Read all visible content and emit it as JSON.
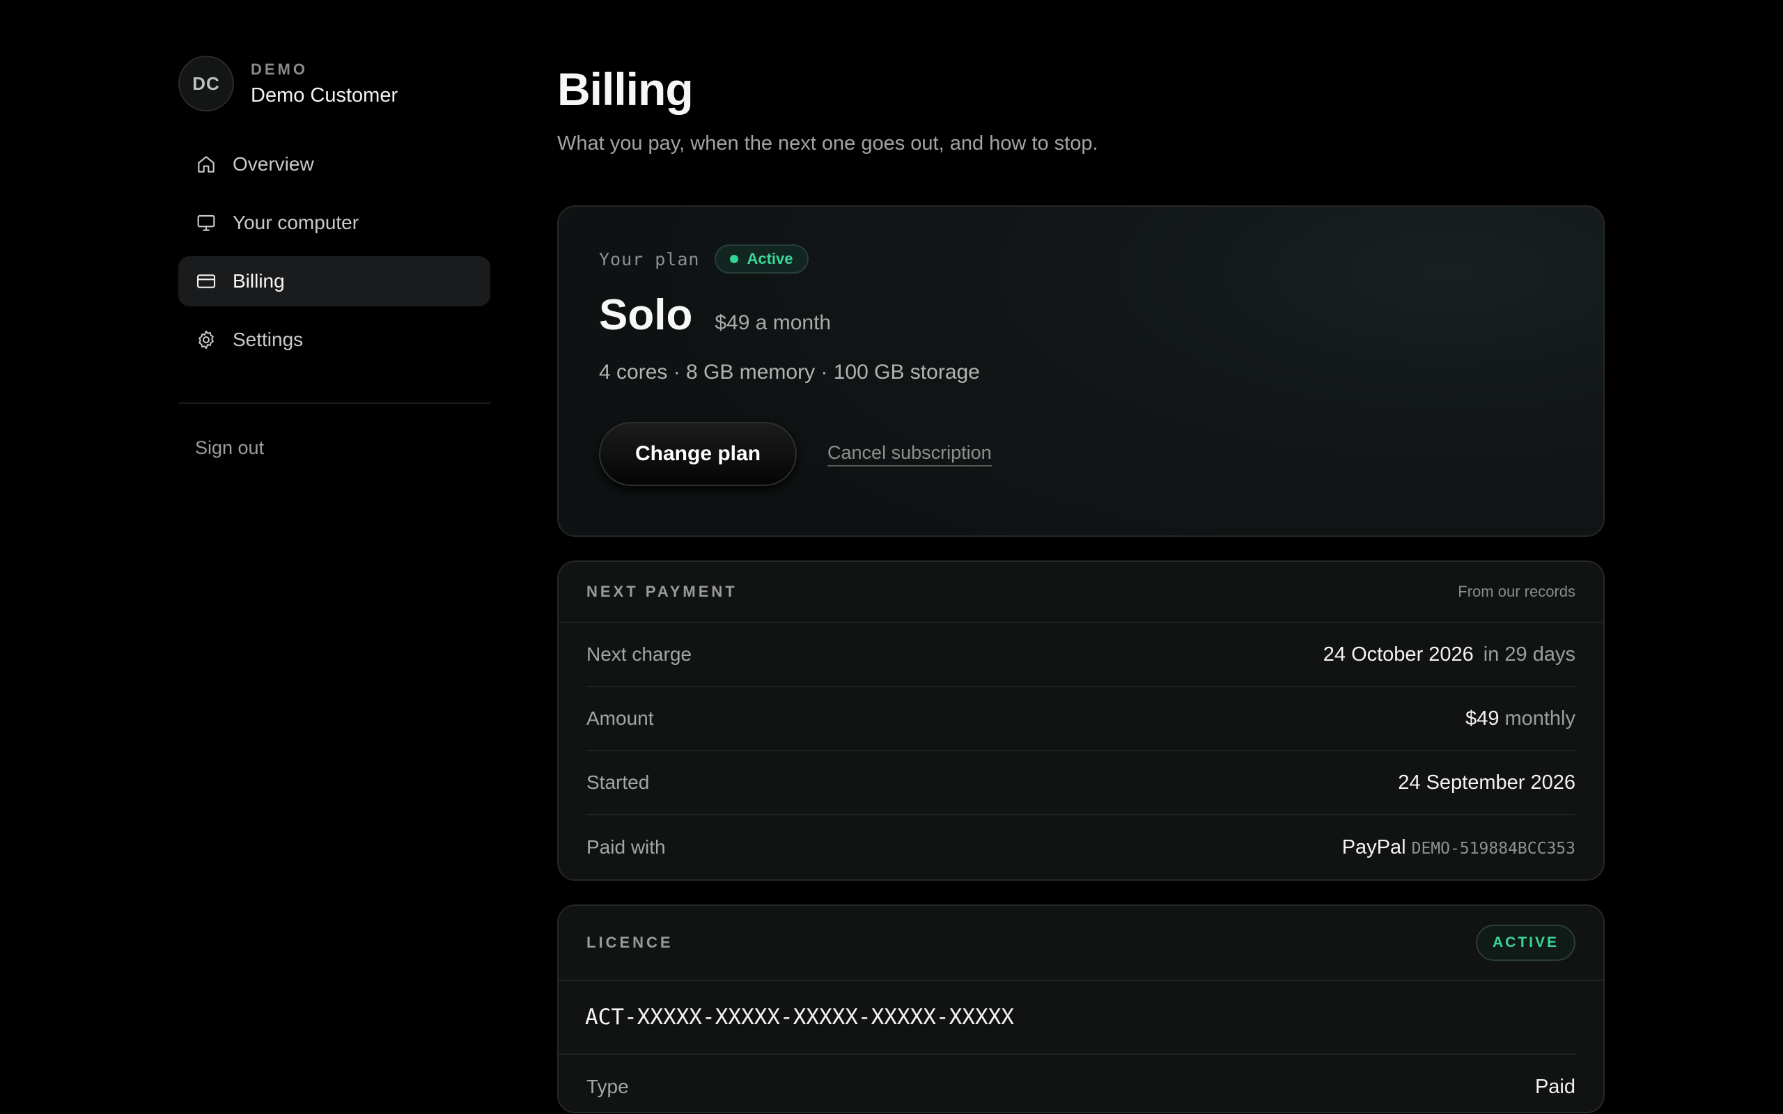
{
  "account": {
    "initials": "DC",
    "tag": "DEMO",
    "name": "Demo Customer"
  },
  "nav": {
    "items": [
      {
        "label": "Overview",
        "icon": "home-icon"
      },
      {
        "label": "Your computer",
        "icon": "monitor-icon"
      },
      {
        "label": "Billing",
        "icon": "credit-card-icon",
        "active": true
      },
      {
        "label": "Settings",
        "icon": "gear-icon"
      }
    ],
    "sign_out": "Sign out"
  },
  "page": {
    "title": "Billing",
    "subtitle": "What you pay, when the next one goes out, and how to stop."
  },
  "plan": {
    "label": "Your plan",
    "status": "Active",
    "name": "Solo",
    "price": "$49 a month",
    "specs": "4 cores · 8 GB memory · 100 GB storage",
    "change_label": "Change plan",
    "cancel_label": "Cancel subscription"
  },
  "next_payment": {
    "title": "NEXT PAYMENT",
    "note": "From our records",
    "rows": [
      {
        "label": "Next charge",
        "value": "24 October 2026",
        "extra": "in 29 days"
      },
      {
        "label": "Amount",
        "value": "$49",
        "extra": "monthly"
      },
      {
        "label": "Started",
        "value": "24 September 2026",
        "extra": ""
      },
      {
        "label": "Paid with",
        "value": "PayPal",
        "code": "DEMO-519884BCC353"
      }
    ]
  },
  "licence": {
    "title": "LICENCE",
    "status": "ACTIVE",
    "key": "ACT-XXXXX-XXXXX-XXXXX-XXXXX-XXXXX",
    "rows": [
      {
        "label": "Type",
        "value": "Paid"
      }
    ]
  },
  "colors": {
    "accent_green": "#34d399",
    "background": "#000000",
    "card": "#111212"
  }
}
